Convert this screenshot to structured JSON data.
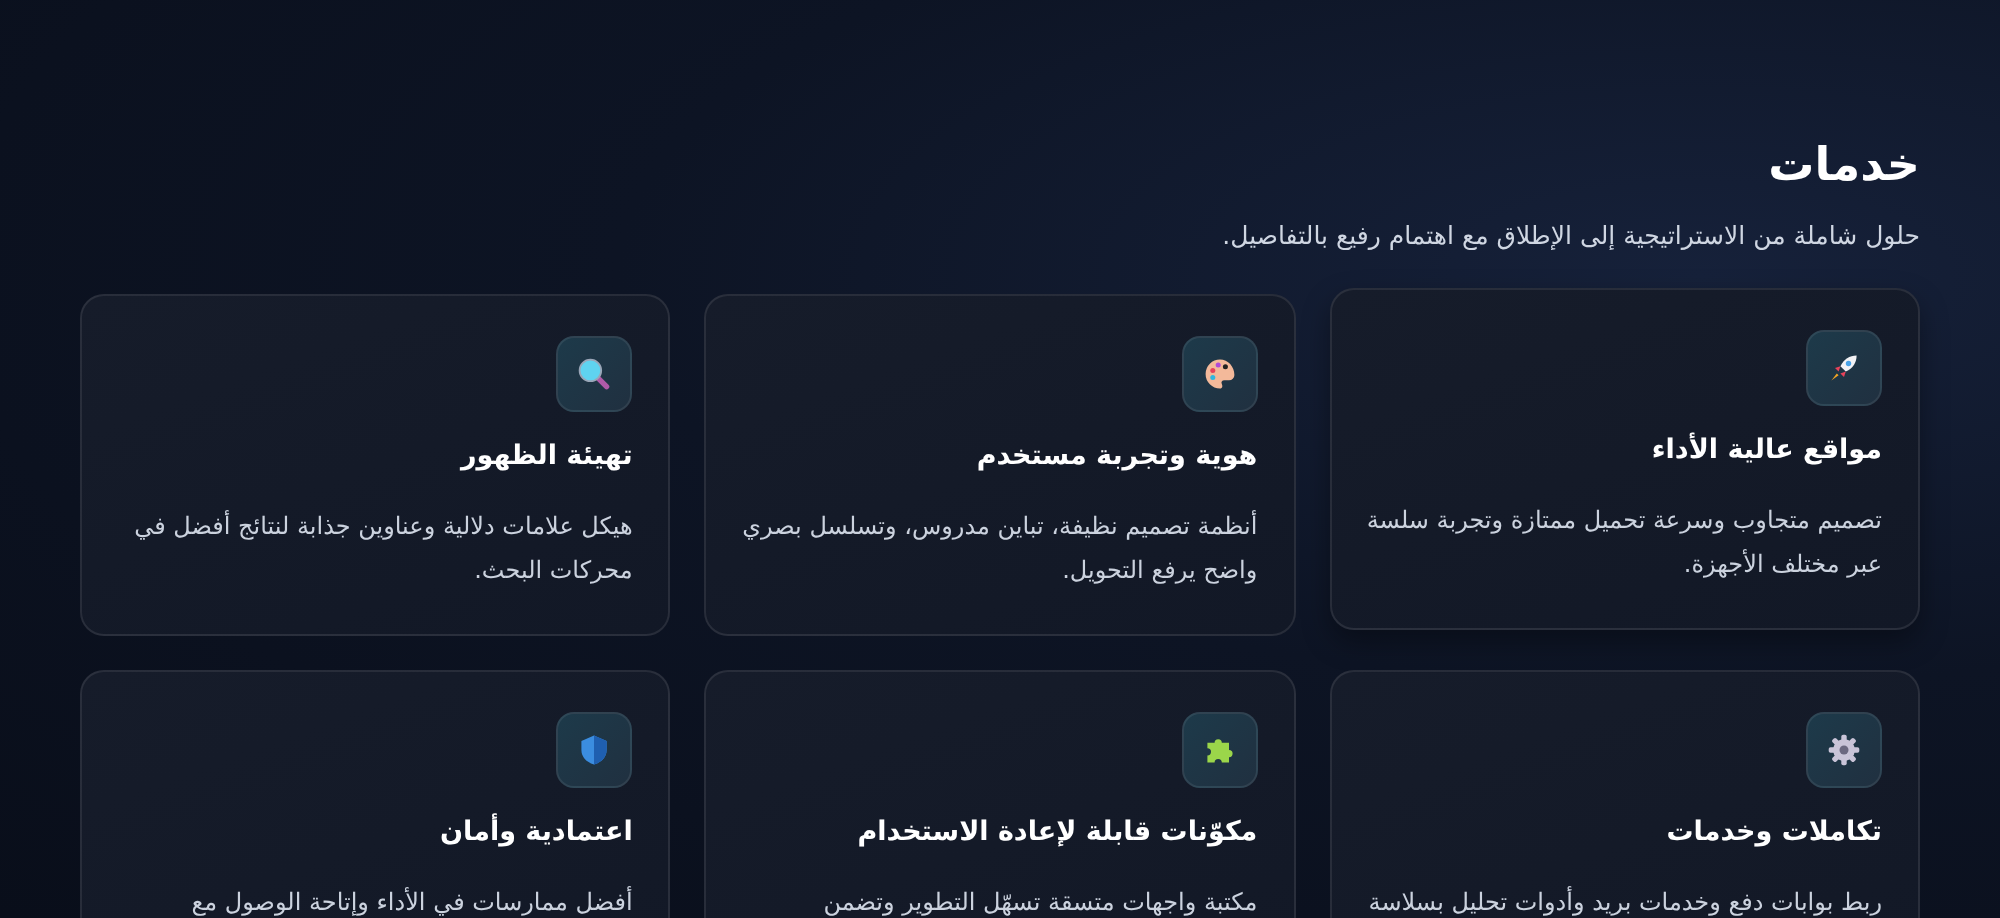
{
  "section": {
    "title": "خدمات",
    "subtitle": "حلول شاملة من الاستراتيجية إلى الإطلاق مع اهتمام رفيع بالتفاصيل."
  },
  "cards": [
    {
      "title": "مواقع عالية الأداء",
      "description": "تصميم متجاوب وسرعة تحميل ممتازة وتجربة سلسة عبر مختلف الأجهزة."
    },
    {
      "title": "هوية وتجربة مستخدم",
      "description": "أنظمة تصميم نظيفة، تباين مدروس، وتسلسل بصري واضح يرفع التحويل."
    },
    {
      "title": "تهيئة الظهور",
      "description": "هيكل علامات دلالية وعناوين جذابة لنتائج أفضل في محركات البحث."
    },
    {
      "title": "تكاملات وخدمات",
      "description": "ربط بوابات دفع وخدمات بريد وأدوات تحليل بسلاسة"
    },
    {
      "title": "مكوّنات قابلة لإعادة الاستخدام",
      "description": "مكتبة واجهات متسقة تسهّل التطوير وتضمن"
    },
    {
      "title": "اعتمادية وأمان",
      "description": "أفضل ممارسات في الأداء وإتاحة الوصول مع"
    }
  ]
}
